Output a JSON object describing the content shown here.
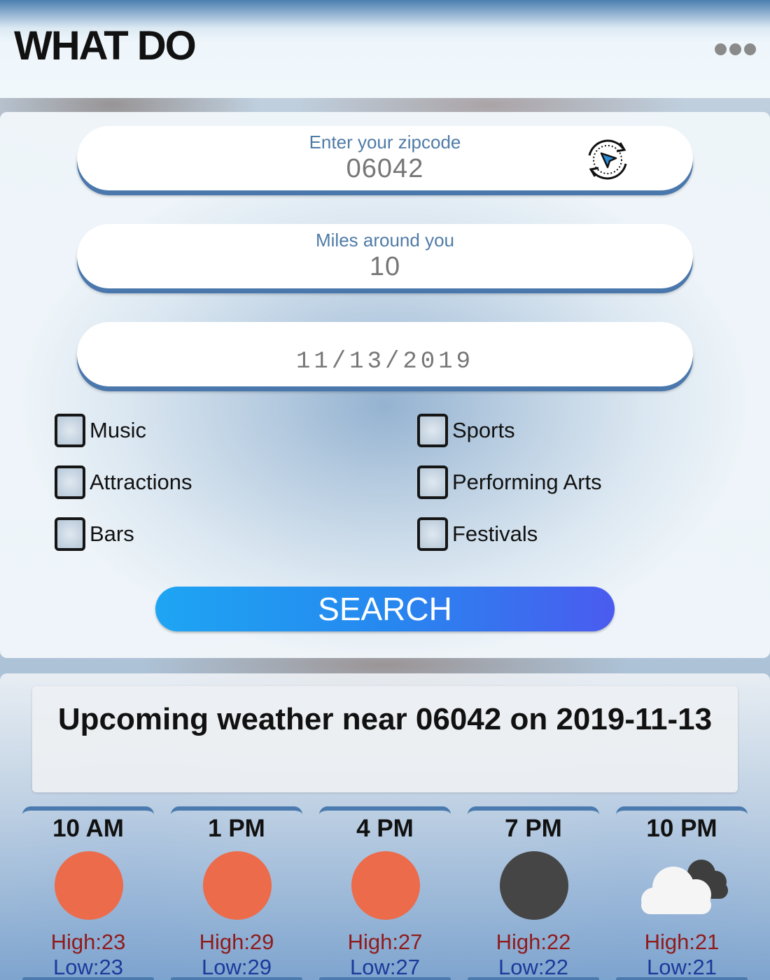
{
  "header": {
    "title": "WHAT DO",
    "menu_icon": "more-dots-icon"
  },
  "form": {
    "zipcode": {
      "label": "Enter your zipcode",
      "value": "06042"
    },
    "locate_icon": "locate-me-icon",
    "miles": {
      "label": "Miles around you",
      "value": "10"
    },
    "date": {
      "value": "11/13/2019"
    },
    "categories": [
      {
        "label": "Music",
        "checked": false
      },
      {
        "label": "Sports",
        "checked": false
      },
      {
        "label": "Attractions",
        "checked": false
      },
      {
        "label": "Performing Arts",
        "checked": false
      },
      {
        "label": "Bars",
        "checked": false
      },
      {
        "label": "Festivals",
        "checked": false
      }
    ],
    "search_label": "SEARCH",
    "search_gradient": [
      "#1ea5f3",
      "#4a5bef"
    ]
  },
  "weather": {
    "title": "Upcoming weather near 06042 on 2019-11-13",
    "forecasts": [
      {
        "time": "10 AM",
        "icon": "sun-icon",
        "color": "#ec6b4b",
        "high": "High:23",
        "low": "Low:23"
      },
      {
        "time": "1 PM",
        "icon": "sun-icon",
        "color": "#ec6b4b",
        "high": "High:29",
        "low": "Low:29"
      },
      {
        "time": "4 PM",
        "icon": "sun-icon",
        "color": "#ec6b4b",
        "high": "High:27",
        "low": "Low:27"
      },
      {
        "time": "7 PM",
        "icon": "moon-icon",
        "color": "#454545",
        "high": "High:22",
        "low": "Low:22"
      },
      {
        "time": "10 PM",
        "icon": "cloudy-icon",
        "color": "#f5f5f5",
        "high": "High:21",
        "low": "Low:21"
      }
    ]
  }
}
